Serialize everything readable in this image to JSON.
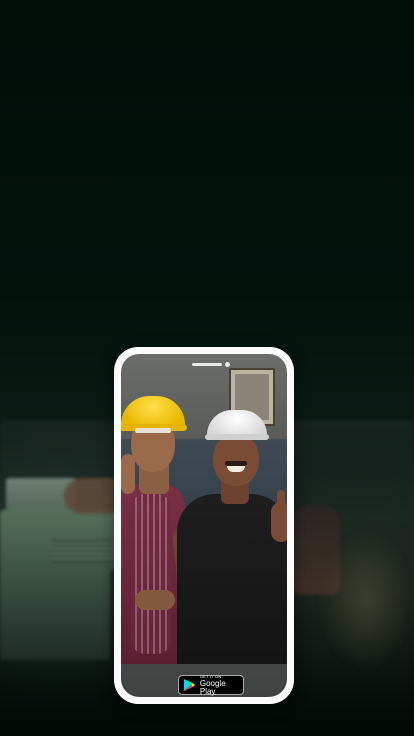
{
  "screen": {
    "background": "#031109"
  },
  "phone_mockup": {
    "frame_color": "#ffffff"
  },
  "store_badge": {
    "top_text": "GET IT ON",
    "main_text": "Google Play",
    "icon": "google-play-icon"
  },
  "photo": {
    "helmet_colors": [
      "#f2c500",
      "#ffffff"
    ]
  }
}
